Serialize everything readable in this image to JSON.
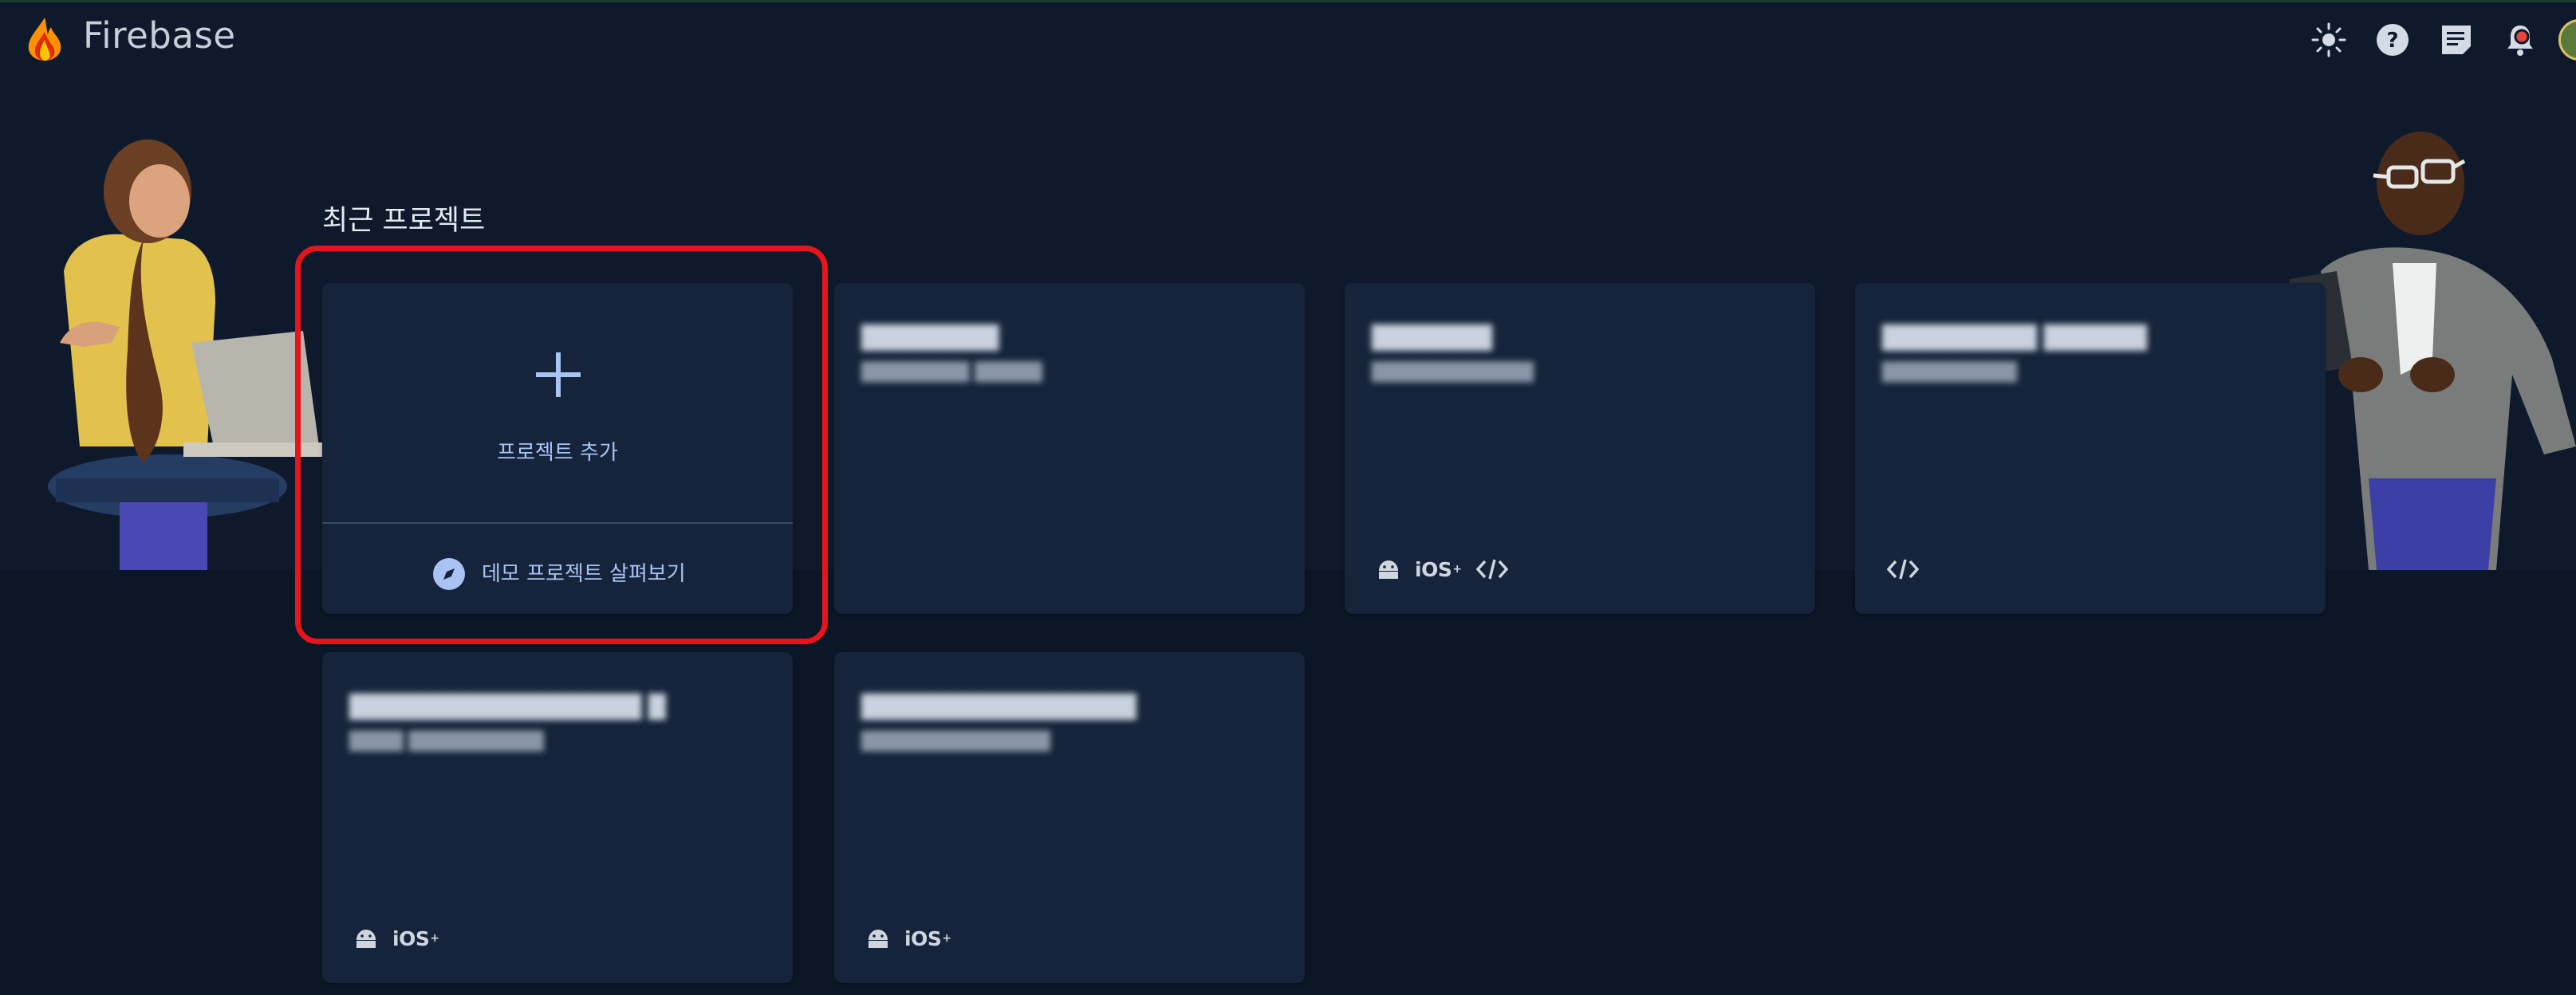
{
  "header": {
    "brand": "Firebase",
    "icons": [
      "theme-icon",
      "help-icon",
      "feedback-icon",
      "notifications-icon",
      "avatar"
    ]
  },
  "section_title": "최근 프로젝트",
  "add_card": {
    "label": "프로젝트 추가",
    "demo_label": "데모 프로젝트 살펴보기"
  },
  "projects": [
    {
      "name": "████████",
      "id": "████████ █████",
      "platforms": []
    },
    {
      "name": "███████",
      "id": "████████████",
      "platforms": [
        "android",
        "ios",
        "web"
      ]
    },
    {
      "name": "█████████ ██████",
      "id": "██████████",
      "platforms": [
        "web"
      ]
    },
    {
      "name": "█████████████████ █",
      "id": "████ ██████████",
      "platforms": [
        "android",
        "ios"
      ]
    },
    {
      "name": "████████████████",
      "id": "██████████████",
      "platforms": [
        "android",
        "ios"
      ]
    }
  ],
  "ios_label": "iOS",
  "ios_sup": "+",
  "colors": {
    "background": "#0b1627",
    "card": "#15243a",
    "accent": "#a9c3f5",
    "highlight": "#e8141c"
  }
}
